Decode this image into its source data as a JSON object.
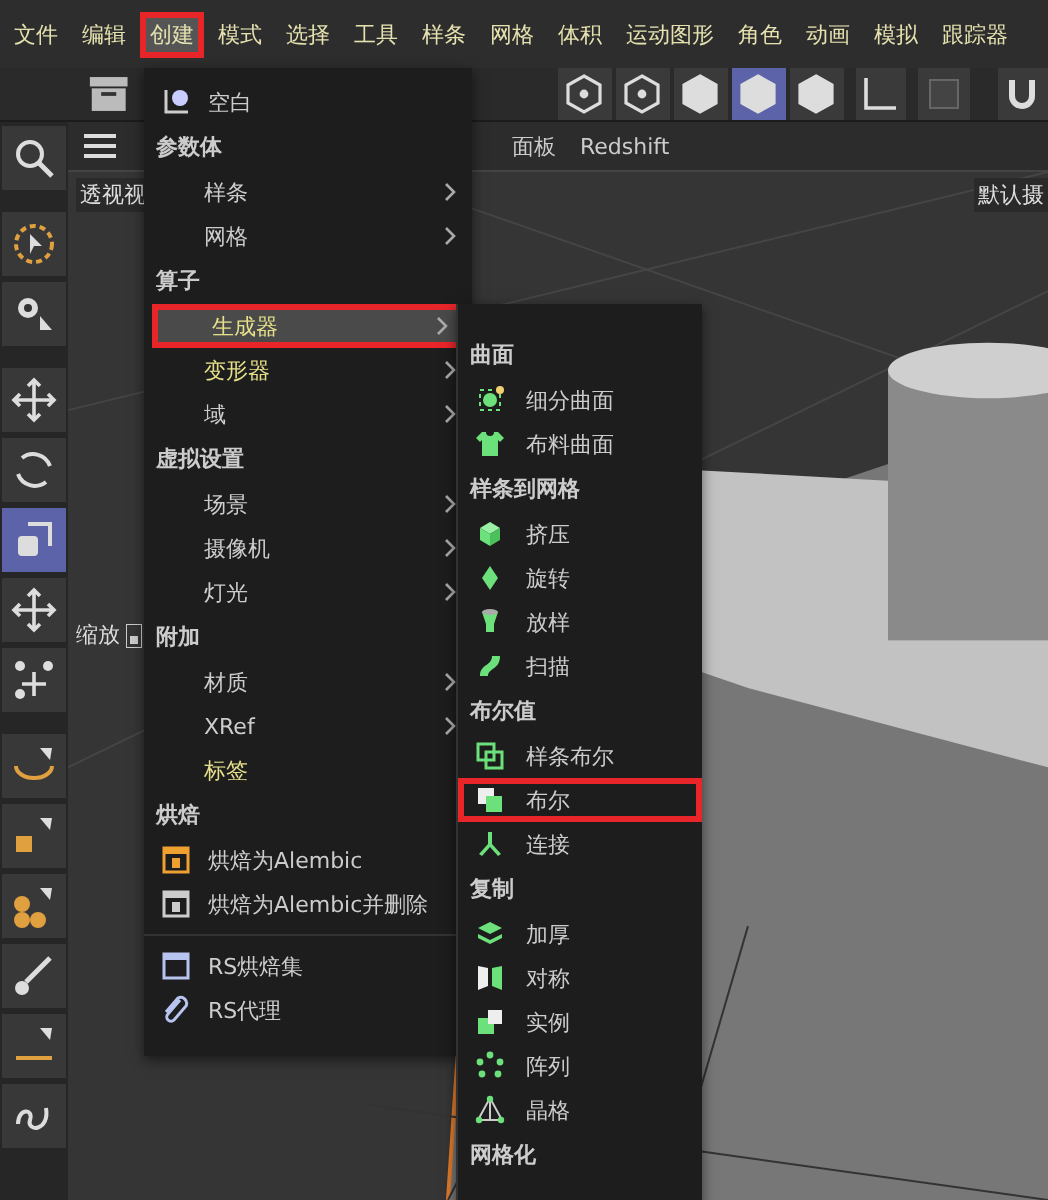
{
  "menu_bar": [
    {
      "label": "文件",
      "selected": false,
      "highlighted": false
    },
    {
      "label": "编辑",
      "selected": false,
      "highlighted": false
    },
    {
      "label": "创建",
      "selected": true,
      "highlighted": true
    },
    {
      "label": "模式",
      "selected": false,
      "highlighted": false
    },
    {
      "label": "选择",
      "selected": false,
      "highlighted": false
    },
    {
      "label": "工具",
      "selected": false,
      "highlighted": false
    },
    {
      "label": "样条",
      "selected": false,
      "highlighted": false
    },
    {
      "label": "网格",
      "selected": false,
      "highlighted": false
    },
    {
      "label": "体积",
      "selected": false,
      "highlighted": false
    },
    {
      "label": "运动图形",
      "selected": false,
      "highlighted": false
    },
    {
      "label": "角色",
      "selected": false,
      "highlighted": false
    },
    {
      "label": "动画",
      "selected": false,
      "highlighted": false
    },
    {
      "label": "模拟",
      "selected": false,
      "highlighted": false
    },
    {
      "label": "跟踪器",
      "selected": false,
      "highlighted": false
    }
  ],
  "view_modes": [
    {
      "selected": false
    },
    {
      "selected": false
    },
    {
      "selected": false
    },
    {
      "selected": true
    },
    {
      "selected": false
    }
  ],
  "tools": [
    {
      "selected": false
    },
    {
      "selected": false
    },
    {
      "selected": false
    },
    {
      "selected": false
    },
    {
      "selected": false
    },
    {
      "selected": true
    },
    {
      "selected": false
    },
    {
      "selected": false
    },
    {
      "selected": false
    },
    {
      "selected": false
    },
    {
      "selected": false
    },
    {
      "selected": false
    },
    {
      "selected": false
    },
    {
      "selected": false
    }
  ],
  "viewport": {
    "tabs": [
      "面板",
      "Redshift"
    ],
    "view_label": "透视视",
    "camera_label": "默认摄",
    "zoom_label": "缩放"
  },
  "create_menu": [
    {
      "kind": "icon",
      "label": "空白"
    },
    {
      "kind": "header",
      "label": "参数体"
    },
    {
      "kind": "submenu",
      "label": "样条",
      "selected": false,
      "highlighted": false,
      "accent": false
    },
    {
      "kind": "submenu",
      "label": "网格",
      "selected": false,
      "highlighted": false,
      "accent": false
    },
    {
      "kind": "header",
      "label": "算子"
    },
    {
      "kind": "submenu",
      "label": "生成器",
      "selected": true,
      "highlighted": true,
      "accent": true
    },
    {
      "kind": "submenu",
      "label": "变形器",
      "selected": false,
      "highlighted": false,
      "accent": true
    },
    {
      "kind": "submenu",
      "label": "域",
      "selected": false,
      "highlighted": false,
      "accent": false
    },
    {
      "kind": "header",
      "label": "虚拟设置"
    },
    {
      "kind": "submenu",
      "label": "场景",
      "selected": false,
      "highlighted": false,
      "accent": false
    },
    {
      "kind": "submenu",
      "label": "摄像机",
      "selected": false,
      "highlighted": false,
      "accent": false
    },
    {
      "kind": "submenu",
      "label": "灯光",
      "selected": false,
      "highlighted": false,
      "accent": false
    },
    {
      "kind": "header",
      "label": "附加"
    },
    {
      "kind": "submenu",
      "label": "材质",
      "selected": false,
      "highlighted": false,
      "accent": false
    },
    {
      "kind": "submenu",
      "label": "XRef",
      "selected": false,
      "highlighted": false,
      "accent": false
    },
    {
      "kind": "plain",
      "label": "标签",
      "accent": true
    },
    {
      "kind": "header",
      "label": "烘焙"
    },
    {
      "kind": "icon",
      "label": "烘焙为Alembic"
    },
    {
      "kind": "icon",
      "label": "烘焙为Alembic并删除"
    },
    {
      "kind": "separator"
    },
    {
      "kind": "icon",
      "label": "RS烘焙集"
    },
    {
      "kind": "icon",
      "label": "RS代理"
    }
  ],
  "generator_menu": [
    {
      "kind": "header",
      "label": "曲面"
    },
    {
      "kind": "icon",
      "label": "细分曲面",
      "highlighted": false
    },
    {
      "kind": "icon",
      "label": "布料曲面",
      "highlighted": false
    },
    {
      "kind": "header",
      "label": "样条到网格"
    },
    {
      "kind": "icon",
      "label": "挤压",
      "highlighted": false
    },
    {
      "kind": "icon",
      "label": "旋转",
      "highlighted": false
    },
    {
      "kind": "icon",
      "label": "放样",
      "highlighted": false
    },
    {
      "kind": "icon",
      "label": "扫描",
      "highlighted": false
    },
    {
      "kind": "header",
      "label": "布尔值"
    },
    {
      "kind": "icon",
      "label": "样条布尔",
      "highlighted": false
    },
    {
      "kind": "icon",
      "label": "布尔",
      "highlighted": true
    },
    {
      "kind": "icon",
      "label": "连接",
      "highlighted": false
    },
    {
      "kind": "header",
      "label": "复制"
    },
    {
      "kind": "icon",
      "label": "加厚",
      "highlighted": false
    },
    {
      "kind": "icon",
      "label": "对称",
      "highlighted": false
    },
    {
      "kind": "icon",
      "label": "实例",
      "highlighted": false
    },
    {
      "kind": "icon",
      "label": "阵列",
      "highlighted": false
    },
    {
      "kind": "icon",
      "label": "晶格",
      "highlighted": false
    },
    {
      "kind": "header",
      "label": "网格化"
    }
  ]
}
